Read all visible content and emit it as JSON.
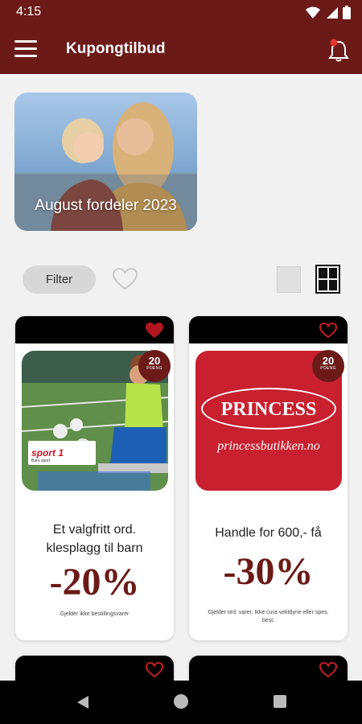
{
  "status_bar": {
    "time": "4:15"
  },
  "app_bar": {
    "title": "Kupongtilbud"
  },
  "hero": {
    "title": "August fordeler 2023"
  },
  "controls": {
    "filter_label": "Filter"
  },
  "cards": [
    {
      "points": "20",
      "points_label": "POENG",
      "description_line1": "Et valgfritt ord.",
      "description_line2": "klesplagg til barn",
      "discount": "-20%",
      "fineprint": "Gjelder ikke bestillingsvarer",
      "logo_text": "sport 1",
      "logo_sub": "Bare sport",
      "favorited": true
    },
    {
      "points": "20",
      "points_label": "POENG",
      "description_line1": "Handle for 600,- få",
      "discount": "-30%",
      "fineprint_line1": "Gjelder ord. varer.  Ikke cura vektdyne eller spes.",
      "fineprint_line2": "best.",
      "logo_text": "PRINCESS",
      "logo_sub": "princessbutikken.no",
      "favorited": false
    }
  ],
  "colors": {
    "brand": "#6b1a17",
    "background": "#f1f1f1",
    "card_header": "#000000",
    "princess_red": "#c8202f"
  }
}
